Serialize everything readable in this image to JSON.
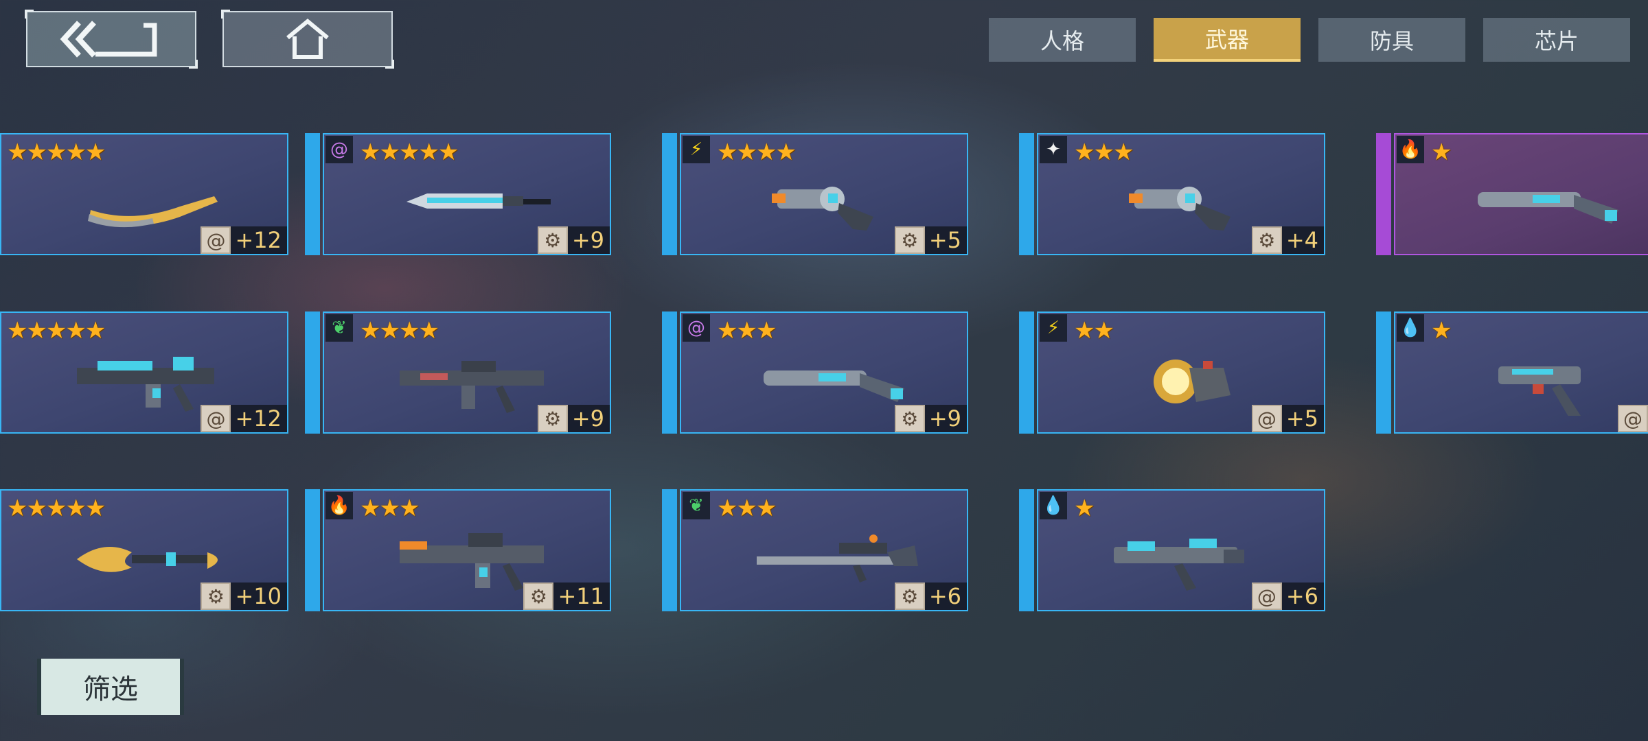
{
  "nav": {
    "back_icon": "double-chevron-back-icon",
    "home_icon": "home-icon"
  },
  "tabs": [
    {
      "label": "人格",
      "active": false
    },
    {
      "label": "武器",
      "active": true
    },
    {
      "label": "防具",
      "active": false
    },
    {
      "label": "芯片",
      "active": false
    }
  ],
  "colors": {
    "tab_active": "#c9a24a",
    "card_border": "#38b6f5",
    "card_strip": "#2ea8ea",
    "purple_border": "#b056e0",
    "star": "#ffb21e",
    "level_text": "#f2d07a"
  },
  "weapons": [
    {
      "element": "",
      "stars": 5,
      "weapon": "golden-curved-blade",
      "level_icon": "spiral-icon",
      "level": "+12"
    },
    {
      "element": "spiral",
      "stars": 5,
      "weapon": "energy-sword",
      "level_icon": "gear-icon",
      "level": "+9"
    },
    {
      "element": "lightning",
      "stars": 4,
      "weapon": "revolver",
      "level_icon": "gear-icon",
      "level": "+5"
    },
    {
      "element": "sparkle",
      "stars": 3,
      "weapon": "revolver",
      "level_icon": "gear-icon",
      "level": "+4"
    },
    {
      "element": "fire",
      "stars": 1,
      "weapon": "shotgun",
      "level_icon": "",
      "level": ""
    },
    {
      "element": "",
      "stars": 5,
      "weapon": "cyber-rifle",
      "level_icon": "spiral-icon",
      "level": "+12"
    },
    {
      "element": "leaf",
      "stars": 4,
      "weapon": "assault-rifle",
      "level_icon": "gear-icon",
      "level": "+9"
    },
    {
      "element": "spiral",
      "stars": 3,
      "weapon": "shotgun",
      "level_icon": "gear-icon",
      "level": "+9"
    },
    {
      "element": "lightning",
      "stars": 2,
      "weapon": "lamp-launcher",
      "level_icon": "spiral-icon",
      "level": "+5"
    },
    {
      "element": "water",
      "stars": 1,
      "weapon": "pistol",
      "level_icon": "spiral-icon",
      "level": ""
    },
    {
      "element": "",
      "stars": 5,
      "weapon": "flame-lance",
      "level_icon": "gear-icon",
      "level": "+10"
    },
    {
      "element": "fire",
      "stars": 3,
      "weapon": "heavy-rifle",
      "level_icon": "gear-icon",
      "level": "+11"
    },
    {
      "element": "leaf",
      "stars": 3,
      "weapon": "sniper-rifle",
      "level_icon": "gear-icon",
      "level": "+6"
    },
    {
      "element": "water",
      "stars": 1,
      "weapon": "smg",
      "level_icon": "spiral-icon",
      "level": "+6"
    }
  ],
  "filter": {
    "label": "筛选"
  }
}
